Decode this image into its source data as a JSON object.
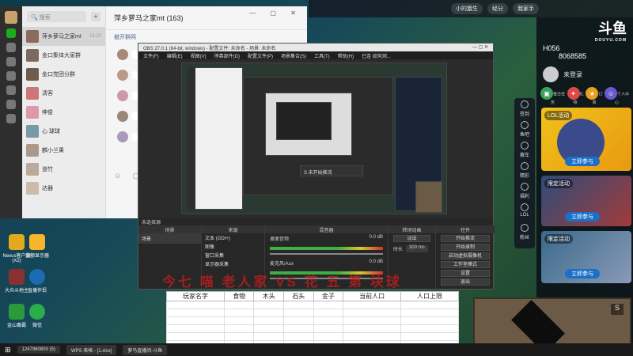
{
  "chat": {
    "search_placeholder": "搜索",
    "title": "萍乡萝马之家mt (163)",
    "subtitle": "撤开群网",
    "conversations": [
      {
        "name": "萍乡萝马之家mt",
        "time": "16:20"
      },
      {
        "name": "金口集体大家群",
        "time": ""
      },
      {
        "name": "金口党团分群",
        "time": ""
      },
      {
        "name": "清客",
        "time": ""
      },
      {
        "name": "绅俊",
        "time": ""
      },
      {
        "name": "心 球球",
        "time": ""
      },
      {
        "name": "麟小兰果",
        "time": ""
      },
      {
        "name": "道竹",
        "time": ""
      },
      {
        "name": "达器",
        "time": ""
      }
    ]
  },
  "topbar": {
    "items": [
      "小的震生",
      "0.0 ...",
      "经分",
      "我家手",
      "乐会"
    ]
  },
  "obs": {
    "title": "OBS 27.0.1 (64-bit, windows) - 配置文件: 未命名 - 场景: 未命名",
    "menu": [
      "文件(F)",
      "编辑(E)",
      "视图(V)",
      "停靠部件(D)",
      "配置文件(P)",
      "场景集合(S)",
      "工具(T)",
      "帮助(H)",
      "已连 如何测..."
    ],
    "status": "未选择源",
    "dock_headers": [
      "场景",
      "来源",
      "混音器",
      "转场动画",
      "控件"
    ],
    "scene": "场景",
    "sources": [
      "文本 (GDI+)",
      "图像",
      "窗口采集",
      "显示器采集"
    ],
    "mixer": [
      {
        "name": "桌面音频",
        "db": "0.0 dB"
      },
      {
        "name": "麦克风/Aux",
        "db": "0.0 dB"
      }
    ],
    "transition": {
      "type": "淡出",
      "duration_label": "时长",
      "duration": "300 ms"
    },
    "controls": [
      "开始推流",
      "开始录制",
      "启动虚拟摄像机",
      "工作室模式",
      "设置",
      "退出"
    ],
    "footer": "LIVE: 00:00:00  REC: 00:00:00  CPU: 4.1%, 30.00 fps"
  },
  "overlay": "今七 喵 老人家 VS 花 五 第 块球",
  "resource_table": {
    "columns": [
      "玩家名字",
      "食物",
      "木头",
      "石头",
      "金子",
      "当前人口",
      "人口上限"
    ]
  },
  "douyu": {
    "logo": "斗鱼",
    "logo_sub": "DOUYU.COM",
    "room_prefix": "H056",
    "room_id": "8068585",
    "login": "未登录",
    "quick": [
      "每日任务",
      "礼物",
      "订阅",
      "个人中心"
    ],
    "cards": [
      {
        "tag": "LOL活动",
        "cta": "立即参与"
      },
      {
        "tag": "限定活动",
        "cta": "立即参与"
      },
      {
        "tag": "限定活动",
        "cta": "立即参与"
      }
    ],
    "side": [
      "签到",
      "鱼吧",
      "赛车",
      "精彩",
      "福利",
      "LOL",
      "粉丝",
      "更多"
    ]
  },
  "desktop_icons": [
    {
      "label": "Nexus客户端 (X2)",
      "color": "#e3a81c"
    },
    {
      "label": "金额显示器",
      "color": "#f7b52c"
    },
    {
      "label": "大众斗地主",
      "color": "#8a3030"
    },
    {
      "label": "直播伴侣",
      "color": "#1e6bb5"
    },
    {
      "label": "金山毒霸",
      "color": "#2a9a3a"
    },
    {
      "label": "微信",
      "color": "#2aae4a"
    }
  ],
  "taskbar": [
    "1247960800 (5)",
    "WPS 表格 - [1.xlsx]",
    "萝马直播间-斗鱼"
  ],
  "minimap_letter": "S"
}
